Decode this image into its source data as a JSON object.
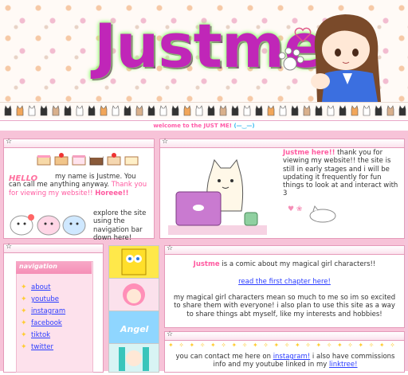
{
  "header": {
    "logo": "Justme"
  },
  "marquee": {
    "text": "welcome to the JUST ME!",
    "emoticon": "(—‿—)"
  },
  "intro": {
    "hello": "HELLO",
    "text_a": "my name is Justme. You can call me anything anyway.",
    "text_b": "Thank you for viewing my website!!",
    "text_c": "Horeee!!",
    "text_d": "explore the site using the navigation bar down here!"
  },
  "welcome": {
    "name": "Justme here!!",
    "text": "thank you for viewing my website!! the site is still in early stages and i will be updating it frequently for fun things to look at and interact with 3"
  },
  "navigation": {
    "title": "navigation",
    "items": [
      {
        "label": "about"
      },
      {
        "label": "youtube"
      },
      {
        "label": "instagram"
      },
      {
        "label": "facebook"
      },
      {
        "label": "tiktok"
      },
      {
        "label": "twitter"
      }
    ]
  },
  "comic": {
    "name": "Justme",
    "text": "is a comic about my magical girl characters!!",
    "link": "read the first chapter here!",
    "body": "my magical girl characters mean so much to me so im so excited to share them with everyone! i also plan to use this site as a way to share things abt myself, like my interests and hobbies!"
  },
  "contact": {
    "text_a": "you can contact me here on",
    "link_a": "instagram!",
    "text_b": "i also have commissions info and my youtube linked in my",
    "link_b": "linktree!"
  },
  "colors": {
    "accent_pink": "#ff5aa0",
    "link_blue": "#2a3cff",
    "page_pink": "#f7c3d8"
  }
}
